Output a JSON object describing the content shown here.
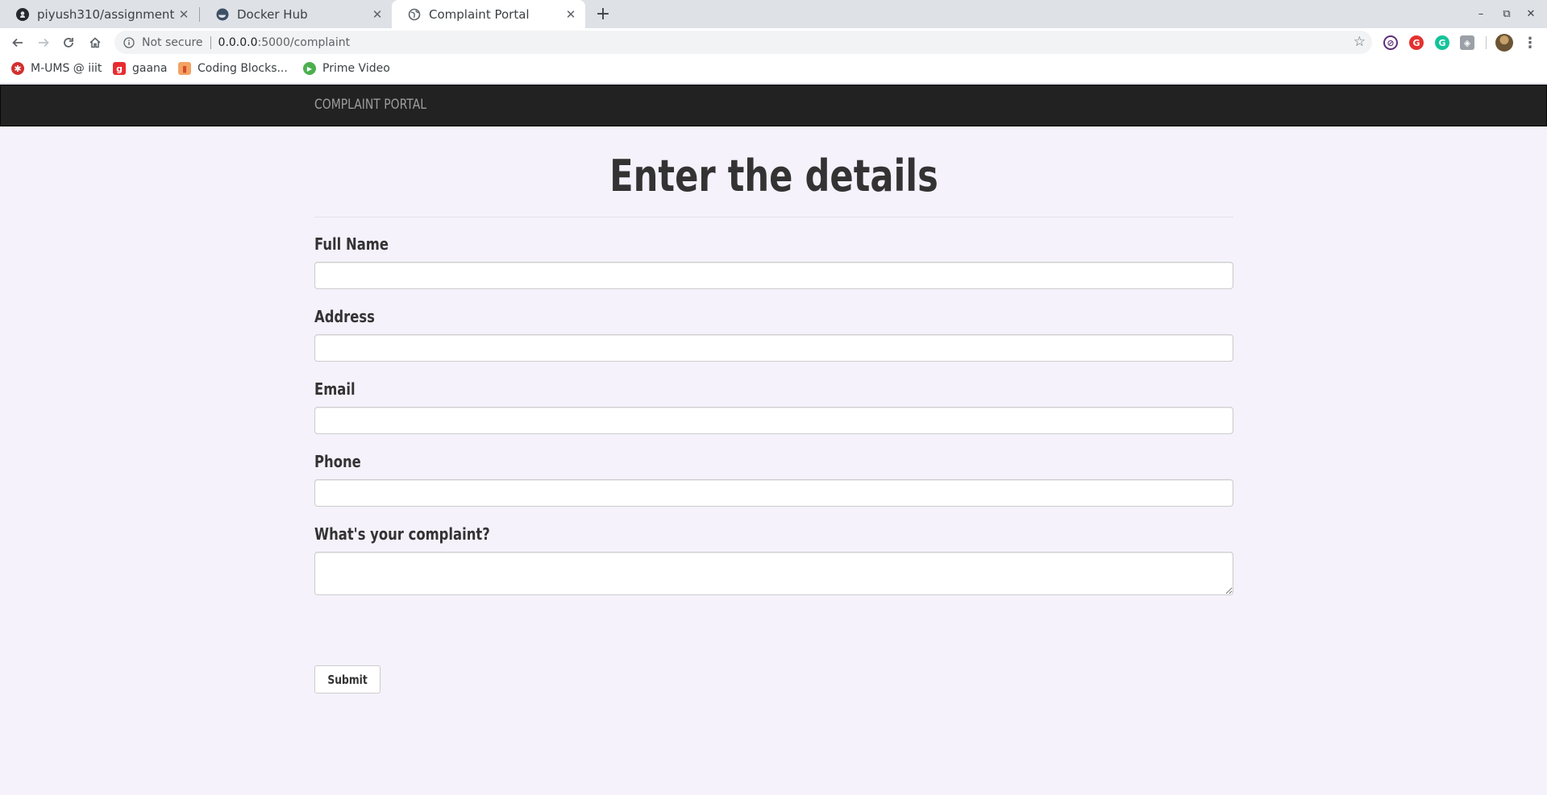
{
  "browser": {
    "tabs": [
      {
        "title": "piyush310/assignment",
        "icon": "github-icon",
        "active": false
      },
      {
        "title": "Docker Hub",
        "icon": "docker-icon",
        "active": false
      },
      {
        "title": "Complaint Portal",
        "icon": "globe-icon",
        "active": true
      }
    ],
    "new_tab": "+",
    "window_controls": {
      "minimize": "–",
      "restore": "⧉",
      "close": "✕"
    },
    "toolbar": {
      "security_label": "Not secure",
      "url_host": "0.0.0.0",
      "url_path": ":5000/complaint",
      "bookmark_star": "☆",
      "menu": "⋮"
    },
    "extensions": [
      {
        "name": "blocker-extension-icon",
        "color": "#5f2e7a",
        "glyph": "⊘"
      },
      {
        "name": "grammarly-style-extension-icon",
        "color": "#e4312f",
        "glyph": "G"
      },
      {
        "name": "grammarly-extension-icon",
        "color": "#15c39a",
        "glyph": "G"
      },
      {
        "name": "shield-extension-icon",
        "color": "#9aa0a6",
        "glyph": "◈"
      }
    ],
    "bookmarks": [
      {
        "label": "M-UMS @ iiit",
        "icon": "bug-icon",
        "color": "#d32f2f",
        "glyph": "✱"
      },
      {
        "label": "gaana",
        "icon": "gaana-icon",
        "color": "#e72c30",
        "glyph": "g"
      },
      {
        "label": "Coding Blocks...",
        "icon": "coding-blocks-icon",
        "color": "#f4a261",
        "glyph": "▮"
      },
      {
        "label": "Prime Video",
        "icon": "prime-video-icon",
        "color": "#4caf50",
        "glyph": "▶"
      }
    ]
  },
  "page": {
    "brand": "COMPLAINT PORTAL",
    "heading": "Enter the details",
    "fields": [
      {
        "label": "Full Name",
        "value": "",
        "type": "text"
      },
      {
        "label": "Address",
        "value": "",
        "type": "text"
      },
      {
        "label": "Email",
        "value": "",
        "type": "text"
      },
      {
        "label": "Phone",
        "value": "",
        "type": "text"
      },
      {
        "label": "What's your complaint?",
        "value": "",
        "type": "textarea"
      }
    ],
    "submit_label": "Submit"
  }
}
